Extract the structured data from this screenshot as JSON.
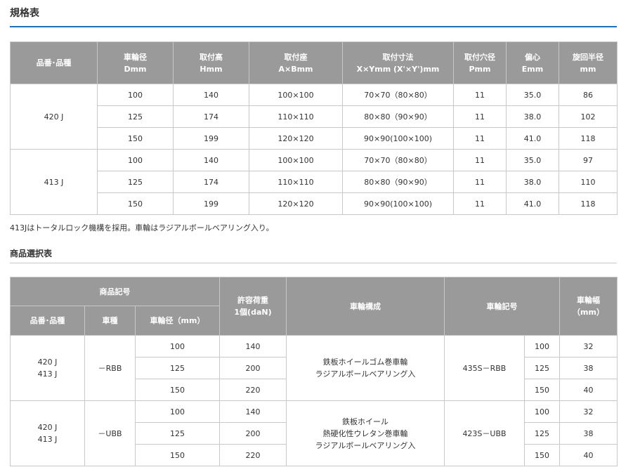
{
  "spec": {
    "title": "規格表",
    "headers": [
      {
        "l1": "品番･品種",
        "l2": ""
      },
      {
        "l1": "車輪径",
        "l2": "Dmm"
      },
      {
        "l1": "取付高",
        "l2": "Hmm"
      },
      {
        "l1": "取付座",
        "l2": "A×Bmm"
      },
      {
        "l1": "取付寸法",
        "l2": "X×Ymm (X'×Y')mm"
      },
      {
        "l1": "取付穴径",
        "l2": "Pmm"
      },
      {
        "l1": "偏心",
        "l2": "Emm"
      },
      {
        "l1": "旋回半径",
        "l2": "mm"
      }
    ],
    "groups": [
      {
        "model": "420 J",
        "rows": [
          [
            "100",
            "140",
            "100×100",
            "70×70（80×80）",
            "11",
            "35.0",
            "86"
          ],
          [
            "125",
            "174",
            "110×110",
            "80×80（90×90）",
            "11",
            "38.0",
            "102"
          ],
          [
            "150",
            "199",
            "120×120",
            "90×90(100×100)",
            "11",
            "41.0",
            "118"
          ]
        ]
      },
      {
        "model": "413 J",
        "rows": [
          [
            "100",
            "140",
            "100×100",
            "70×70（80×80）",
            "11",
            "35.0",
            "97"
          ],
          [
            "125",
            "174",
            "110×110",
            "80×80（90×90）",
            "11",
            "38.0",
            "110"
          ],
          [
            "150",
            "199",
            "120×120",
            "90×90(100×100)",
            "11",
            "41.0",
            "118"
          ]
        ]
      }
    ],
    "note": "413Jはトータルロック機構を採用。車輪はラジアルボールベアリング入り。"
  },
  "selection": {
    "title": "商品選択表",
    "headers": {
      "product_code": "商品記号",
      "model": "品番･品種",
      "type": "車種",
      "diameter": "車輪径（mm）",
      "load_l1": "許容荷重",
      "load_l2": "1個(daN)",
      "composition": "車輪構成",
      "wheel_code": "車輪記号",
      "width_l1": "車輪幅",
      "width_l2": "（mm）"
    },
    "groups": [
      {
        "models": [
          "420 J",
          "413 J"
        ],
        "type": "－RBB",
        "composition": [
          "鉄板ホイールゴム巻車輪",
          "ラジアルボールベアリング入"
        ],
        "wheel_code": "435S－RBB",
        "rows": [
          {
            "diameter": "100",
            "load": "140",
            "wheel_dia": "100",
            "width": "32"
          },
          {
            "diameter": "125",
            "load": "200",
            "wheel_dia": "125",
            "width": "38"
          },
          {
            "diameter": "150",
            "load": "220",
            "wheel_dia": "150",
            "width": "40"
          }
        ]
      },
      {
        "models": [
          "420 J",
          "413 J"
        ],
        "type": "－UBB",
        "composition": [
          "鉄板ホイール",
          "熱硬化性ウレタン巻車輪",
          "ラジアルボールベアリング入"
        ],
        "wheel_code": "423S－UBB",
        "rows": [
          {
            "diameter": "100",
            "load": "140",
            "wheel_dia": "100",
            "width": "32"
          },
          {
            "diameter": "125",
            "load": "200",
            "wheel_dia": "125",
            "width": "38"
          },
          {
            "diameter": "150",
            "load": "220",
            "wheel_dia": "150",
            "width": "40"
          }
        ]
      }
    ]
  }
}
